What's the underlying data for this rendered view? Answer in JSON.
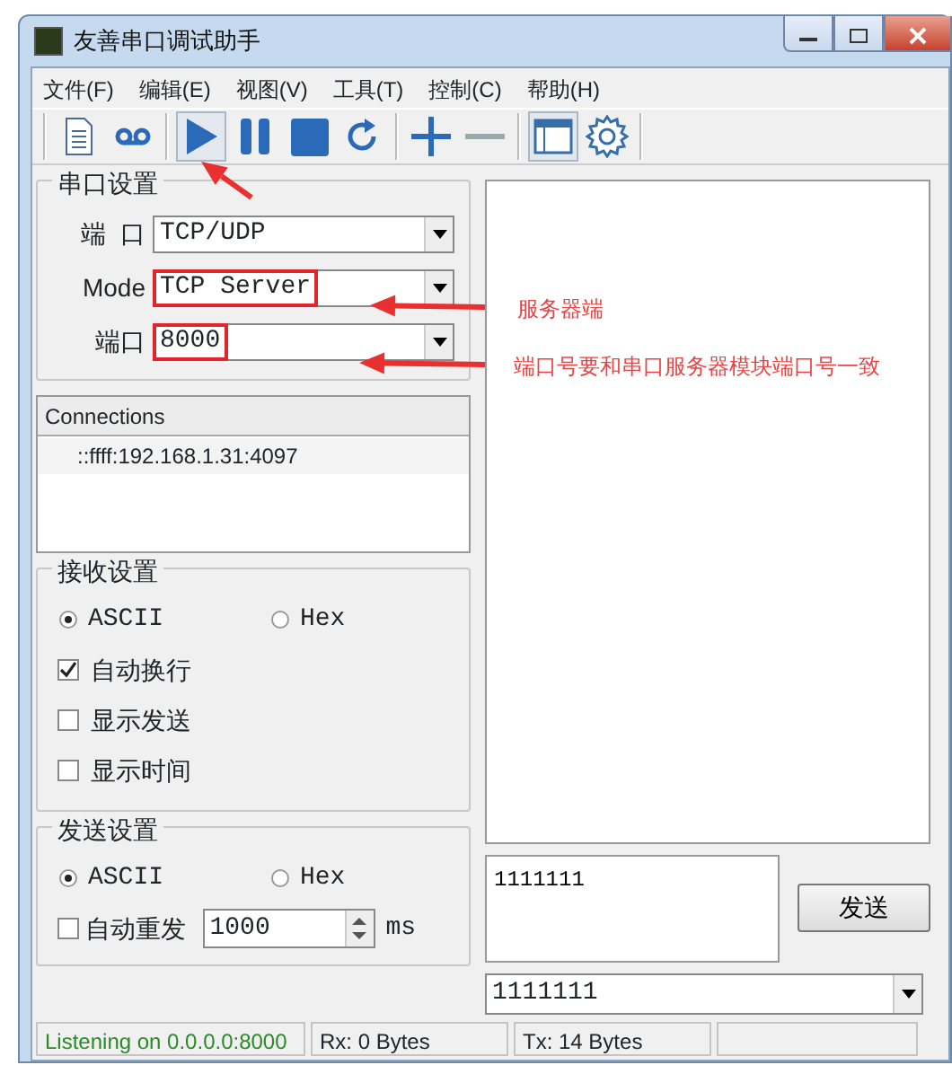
{
  "window": {
    "title": "友善串口调试助手"
  },
  "menu": [
    "文件(F)",
    "编辑(E)",
    "视图(V)",
    "工具(T)",
    "控制(C)",
    "帮助(H)"
  ],
  "toolbar": [
    {
      "pressed": false
    },
    {
      "pressed": false
    },
    {
      "pressed": true
    },
    {
      "pressed": false
    },
    {
      "pressed": false
    },
    {
      "pressed": false
    },
    {
      "pressed": false
    },
    {
      "pressed": false
    },
    {
      "pressed": true
    },
    {
      "pressed": false
    }
  ],
  "serial_settings": {
    "title": "串口设置",
    "fields": [
      {
        "label": "端  口",
        "value": "TCP/UDP",
        "highlighted": false
      },
      {
        "label": "Mode",
        "value": "TCP Server",
        "highlighted": true
      },
      {
        "label": "端口",
        "value": "8000",
        "highlighted": true
      }
    ]
  },
  "connections": {
    "header": "Connections",
    "items": [
      "::ffff:192.168.1.31:4097"
    ]
  },
  "receive_settings": {
    "title": "接收设置",
    "encodings": [
      {
        "label": "ASCII",
        "selected": true
      },
      {
        "label": "Hex",
        "selected": false
      }
    ],
    "checkboxes": [
      {
        "label": "自动换行",
        "checked": true
      },
      {
        "label": "显示发送",
        "checked": false
      },
      {
        "label": "显示时间",
        "checked": false
      }
    ]
  },
  "send_settings": {
    "title": "发送设置",
    "encodings": [
      {
        "label": "ASCII",
        "selected": true
      },
      {
        "label": "Hex",
        "selected": false
      }
    ],
    "auto_resend": {
      "label": "自动重发",
      "checked": false,
      "value": "1000",
      "unit": "ms"
    }
  },
  "send_box": {
    "value": "1111111"
  },
  "send_button": "发送",
  "history": {
    "value": "1111111"
  },
  "status_bar": [
    "Listening on 0.0.0.0:8000",
    "Rx: 0 Bytes",
    "Tx: 14 Bytes"
  ],
  "annotations": [
    {
      "text": "服务器端"
    },
    {
      "text": "端口号要和串口服务器模块端口号一致"
    }
  ]
}
